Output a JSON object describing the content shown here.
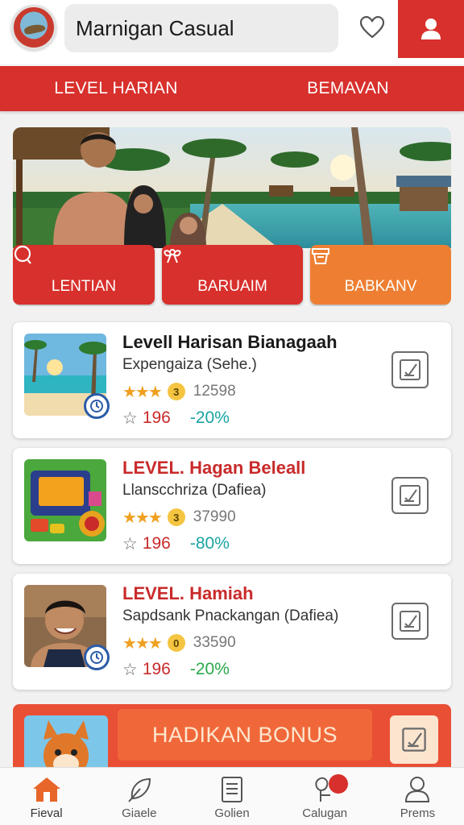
{
  "header": {
    "app_title": "Marnigan Casual",
    "logo_icon": "island-logo-icon",
    "heart_icon": "heart-icon",
    "user_icon": "user-icon"
  },
  "tabs": [
    {
      "label": "LEVEL HARIAN"
    },
    {
      "label": "BEMAVAN"
    }
  ],
  "hero": {
    "buttons": [
      {
        "label": "LENTIAN",
        "icon": "search-icon"
      },
      {
        "label": "BARUAIM",
        "icon": "bow-icon"
      },
      {
        "label": "BABKANV",
        "icon": "box-icon"
      }
    ]
  },
  "cards": [
    {
      "title": "Levell Harisan Bianagaah",
      "subtitle": "Expengaiza (Sehe.)",
      "coin": "3",
      "count": "12598",
      "points": "196",
      "discount": "-20%"
    },
    {
      "title": "LEVEL. Hagan Beleall",
      "subtitle": "Llanscchriza (Dafiea)",
      "coin": "3",
      "count": "37990",
      "points": "196",
      "discount": "-80%"
    },
    {
      "title": "LEVEL. Hamiah",
      "subtitle": "Sapdsank Pnackangan (Dafiea)",
      "coin": "0",
      "count": "33590",
      "points": "196",
      "discount": "-20%"
    }
  ],
  "bonus": {
    "label": "HADIKAN BONUS"
  },
  "bottom_nav": [
    {
      "label": "Fieval",
      "icon": "home-icon"
    },
    {
      "label": "Giaele",
      "icon": "leaf-icon"
    },
    {
      "label": "Golien",
      "icon": "document-icon"
    },
    {
      "label": "Calugan",
      "icon": "map-pin-icon"
    },
    {
      "label": "Prems",
      "icon": "profile-icon"
    }
  ],
  "colors": {
    "brand_red": "#d8302c",
    "accent_orange": "#ee7f32",
    "discount_teal": "#1aa3a3",
    "discount_green": "#2aa84a"
  }
}
